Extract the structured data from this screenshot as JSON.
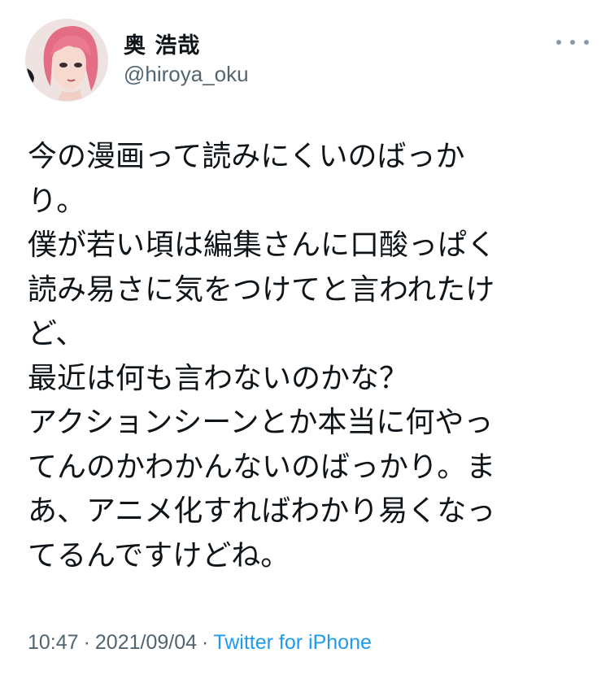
{
  "author": {
    "display_name": "奥 浩哉",
    "handle": "@hiroya_oku",
    "avatar_icon": "profile-avatar-pink-hair"
  },
  "tweet": {
    "lines": [
      "今の漫画って読みにくいのばっか",
      "り。",
      "僕が若い頃は編集さんに口酸っぱく",
      "読み易さに気をつけてと言われたけ",
      "ど、",
      "最近は何も言わないのかな？",
      "アクションシーンとか本当に何やっ",
      "てんのかわかんないのばっかり。ま",
      "あ、アニメ化すればわかり易くなっ",
      "てるんですけどね。"
    ],
    "time": "10:47",
    "separator": "·",
    "date": "2021/09/04",
    "source": "Twitter for iPhone"
  },
  "icons": {
    "more": "more-horizontal-icon"
  },
  "colors": {
    "text": "#0f1419",
    "muted": "#536471",
    "link": "#1d9bf0",
    "icon": "#8b98a5"
  }
}
